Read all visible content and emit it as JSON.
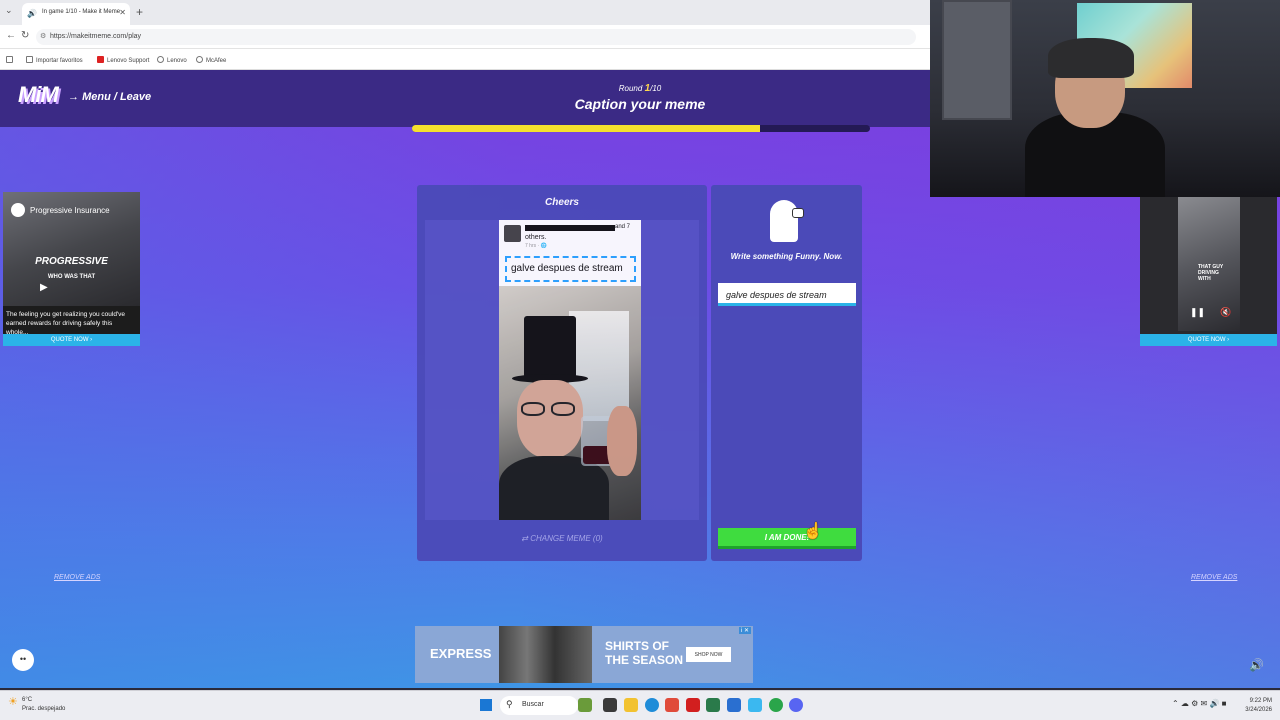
{
  "browser": {
    "tab_title": "In game 1/10 - Make it Meme",
    "url": "https://makeitmeme.com/play",
    "bookmarks": [
      "Importar favoritos",
      "Lenovo Support",
      "Lenovo",
      "McAfee"
    ]
  },
  "game": {
    "logo": "MiM",
    "menu_leave": "Menu / Leave",
    "round_label": "Round",
    "round_current": "1",
    "round_total": "/10",
    "title": "Caption your meme",
    "progress_fraction": 0.76
  },
  "meme": {
    "title": "Cheers",
    "post_and": "and 7",
    "post_others": "others.",
    "post_time": "7 hrs · 🌐",
    "caption_text": "galve despues de stream",
    "change_meme_label": "CHANGE MEME (0)"
  },
  "writer": {
    "prompt": "Write something Funny. Now.",
    "input_value": "galve despues de stream",
    "done_label": "I AM DONE!"
  },
  "ads": {
    "left": {
      "brand": "Progressive Insurance",
      "headline": "PROGRESSIVE",
      "subline": "WHO WAS THAT",
      "description": "The feeling you get realizing you could've earned rewards for driving safely this whole...",
      "cta": "QUOTE NOW ›"
    },
    "right": {
      "overlay_text": "THAT GUY DRIVING WITH",
      "cta": "QUOTE NOW ›"
    },
    "remove_ads_label": "REMOVE ADS",
    "bottom": {
      "brand": "EXPRESS",
      "headline_line1": "SHIRTS OF",
      "headline_line2": "THE SEASON",
      "cta": "SHOP NOW",
      "adchoice": "i ✕"
    }
  },
  "taskbar": {
    "weather_temp": "6°C",
    "weather_desc": "Prac. despejado",
    "search_placeholder": "Buscar",
    "time": "9:22 PM",
    "date": "3/24/2026"
  }
}
